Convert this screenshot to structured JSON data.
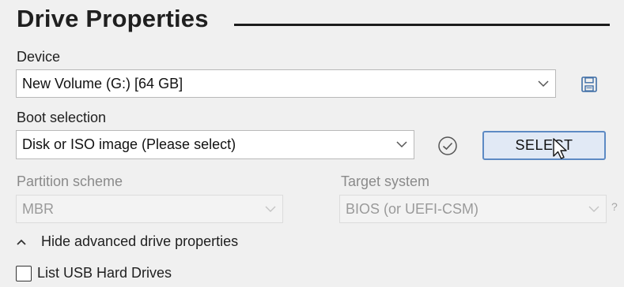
{
  "section": {
    "title": "Drive Properties"
  },
  "device": {
    "label": "Device",
    "value": "New Volume (G:) [64 GB]",
    "save_icon": "save-icon"
  },
  "boot": {
    "label": "Boot selection",
    "value": "Disk or ISO image (Please select)",
    "check_icon": "check-circle-icon",
    "select_label": "SELECT"
  },
  "partition": {
    "label": "Partition scheme",
    "value": "MBR"
  },
  "target": {
    "label": "Target system",
    "value": "BIOS (or UEFI-CSM)",
    "help": "?"
  },
  "advanced": {
    "toggle_label": "Hide advanced drive properties"
  },
  "options": {
    "list_usb_label": "List USB Hard Drives",
    "list_usb_checked": false
  },
  "colors": {
    "accent": "#5d8ac4",
    "select_bg": "#e1e9f5",
    "window_bg": "#f0f0f0"
  }
}
